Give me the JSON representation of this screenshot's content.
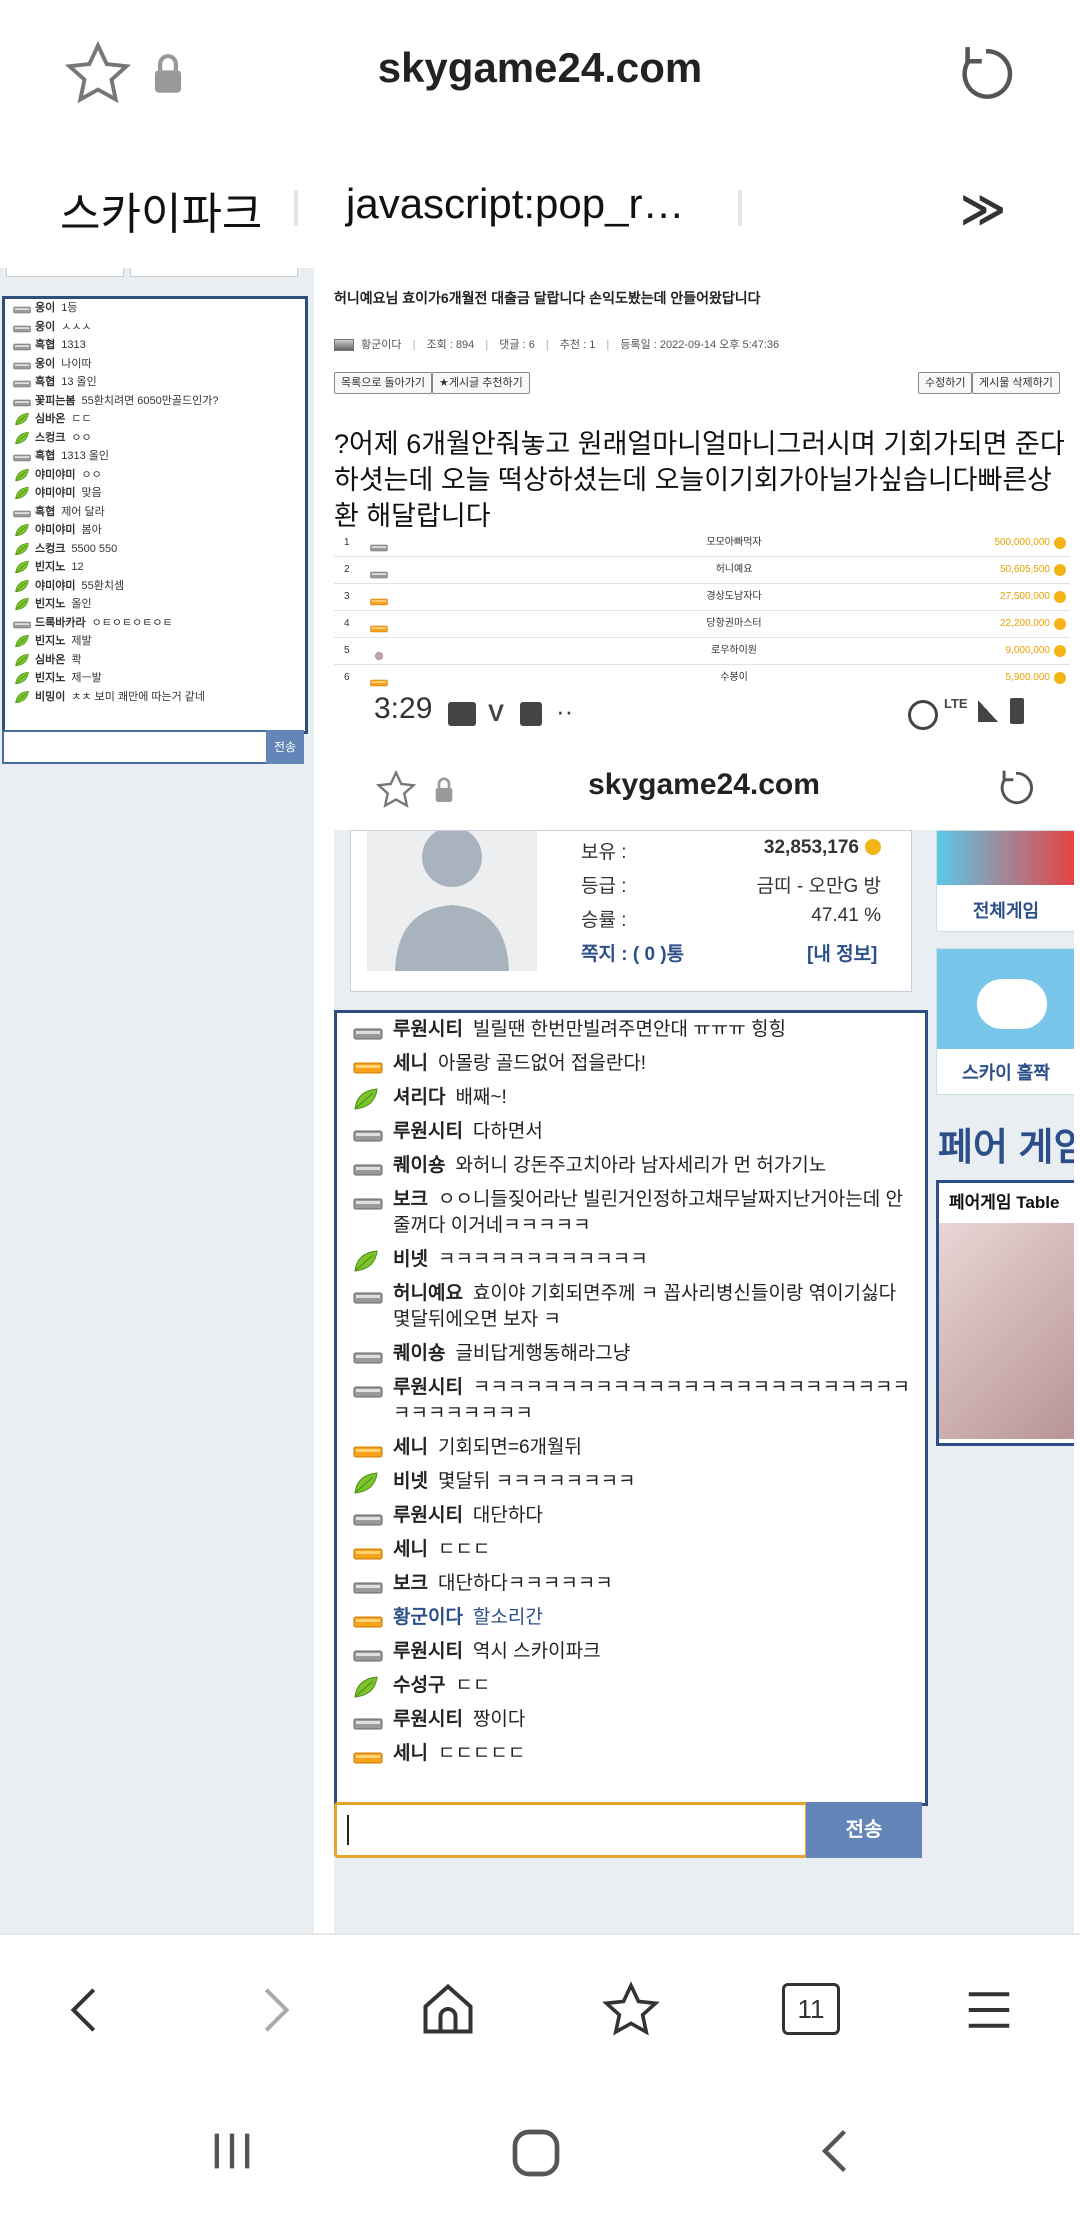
{
  "browser": {
    "url": "skygame24.com",
    "bookmarks": [
      "스카이파크",
      "javascript:pop_r…"
    ],
    "more": "≫"
  },
  "left_chat": {
    "lines": [
      {
        "user": "웅이",
        "msg": "1등",
        "icon": "gray"
      },
      {
        "user": "웅이",
        "msg": "ㅅㅅㅅ",
        "icon": "gray"
      },
      {
        "user": "흑협",
        "msg": "1313",
        "icon": "gray"
      },
      {
        "user": "웅이",
        "msg": "나이따",
        "icon": "gray"
      },
      {
        "user": "흑협",
        "msg": "13 올인",
        "icon": "gray"
      },
      {
        "user": "꽃피는봄",
        "msg": "55환치려면 6050만골드인가?",
        "icon": "gray"
      },
      {
        "user": "심바온",
        "msg": "ㄷㄷ",
        "icon": "leaf"
      },
      {
        "user": "스컹크",
        "msg": "ㅇㅇ",
        "icon": "leaf"
      },
      {
        "user": "흑협",
        "msg": "1313 올인",
        "icon": "gray"
      },
      {
        "user": "야미야미",
        "msg": "ㅇㅇ",
        "icon": "leaf"
      },
      {
        "user": "야미야미",
        "msg": "맞음",
        "icon": "leaf"
      },
      {
        "user": "흑협",
        "msg": "제어 달라",
        "icon": "gray"
      },
      {
        "user": "야미야미",
        "msg": "봄아",
        "icon": "leaf"
      },
      {
        "user": "스컹크",
        "msg": "5500 550",
        "icon": "leaf"
      },
      {
        "user": "빈지노",
        "msg": "12",
        "icon": "leaf"
      },
      {
        "user": "야미야미",
        "msg": "55환치셈",
        "icon": "leaf"
      },
      {
        "user": "빈지노",
        "msg": "올인",
        "icon": "leaf"
      },
      {
        "user": "드록바카라",
        "msg": "ㅇㅌㅇㅌㅇㅌㅇㅌ",
        "icon": "gray"
      },
      {
        "user": "빈지노",
        "msg": "제발",
        "icon": "leaf"
      },
      {
        "user": "심바온",
        "msg": "콱",
        "icon": "leaf"
      },
      {
        "user": "빈지노",
        "msg": "제ㅡ발",
        "icon": "leaf"
      },
      {
        "user": "비밍이",
        "msg": "ㅊㅊ 보미 쾌만에 따는거 같네",
        "icon": "leaf"
      }
    ],
    "send_label": "전송"
  },
  "post": {
    "title": "허니예요님  효이가6개월전 대출금 달랍니다 손익도봤는데 안들어왔답니다",
    "author": "황군이다",
    "views": "조회 : 894",
    "comments": "댓글 : 6",
    "recommend": "추천 : 1",
    "date": "등록일 : 2022-09-14 오후 5:47:36",
    "btn_list": "목록으로 돌아가기",
    "btn_recommend": "★게시글 추천하기",
    "btn_edit": "수정하기",
    "btn_delete": "게시물 삭제하기",
    "body": "?어제 6개월안줘놓고 원래얼마니얼마니그러시며 기회가되면 준다하셧는데 오늘 떡상하셨는데 오늘이기회가아닐가싶습니다빠른상환 해달랍니다"
  },
  "rank_table": [
    {
      "rank": "1",
      "name": "모모아빠먹자",
      "amount": "500,000,000",
      "icon": "gray"
    },
    {
      "rank": "2",
      "name": "허니예요",
      "amount": "50,605,500",
      "icon": "gray"
    },
    {
      "rank": "3",
      "name": "경상도남자다",
      "amount": "27,500,000",
      "icon": "orange"
    },
    {
      "rank": "4",
      "name": "당항권마스터",
      "amount": "22,200,000",
      "icon": "orange"
    },
    {
      "rank": "5",
      "name": "로우하이원",
      "amount": "9,000,000",
      "icon": "badge"
    },
    {
      "rank": "6",
      "name": "수봉이",
      "amount": "5,900,000",
      "icon": "orange"
    }
  ],
  "status": {
    "time": "3:29"
  },
  "inner": {
    "url": "skygame24.com",
    "profile": {
      "balance_label": "보유 :",
      "balance": "32,853,176",
      "grade_label": "등급 :",
      "grade": "금띠 - 오만G 방",
      "winrate_label": "승률 :",
      "winrate": "47.41 %",
      "messages": "쪽지 : ( 0 )통",
      "my_info": "[내 정보]"
    },
    "side": {
      "all_games": "전체게임",
      "sky_holjjak": "스카이 홀짝",
      "pair_game": "페어 게임",
      "pair_table": "페어게임 Table"
    },
    "chat": [
      {
        "user": "루원시티",
        "msg": "빌릴땐 한번만빌려주면안대 ㅠㅠㅠ 힝힝",
        "icon": "gray"
      },
      {
        "user": "세니",
        "msg": "아몰랑 골드없어 접을란다!",
        "icon": "orange"
      },
      {
        "user": "셔리다",
        "msg": "배째~!",
        "icon": "leaf"
      },
      {
        "user": "루원시티",
        "msg": "다하면서",
        "icon": "gray"
      },
      {
        "user": "퀘이숑",
        "msg": "와허니 강돈주고치아라 남자세리가 먼 허가기노",
        "icon": "gray"
      },
      {
        "user": "보크",
        "msg": "ㅇㅇ니들짖어라난 빌린거인정하고채무날짜지난거아는데 안줄꺼다 이거네ㅋㅋㅋㅋㅋ",
        "icon": "gray"
      },
      {
        "user": "비넷",
        "msg": "ㅋㅋㅋㅋㅋㅋㅋㅋㅋㅋㅋㅋ",
        "icon": "leaf"
      },
      {
        "user": "허니예요",
        "msg": "효이야 기회되면주께 ㅋ 꼽사리병신들이랑 엮이기싫다 몇달뒤에오면 보자 ㅋ",
        "icon": "gray"
      },
      {
        "user": "퀘이숑",
        "msg": "글비답게행동해라그냥",
        "icon": "gray"
      },
      {
        "user": "루원시티",
        "msg": "ㅋㅋㅋㅋㅋㅋㅋㅋㅋㅋㅋㅋㅋㅋㅋㅋㅋㅋㅋㅋㅋㅋㅋㅋㅋㅋㅋㅋㅋㅋㅋㅋㅋ",
        "icon": "gray"
      },
      {
        "user": "세니",
        "msg": "기회되면=6개월뒤",
        "icon": "orange"
      },
      {
        "user": "비넷",
        "msg": "몇달뒤 ㅋㅋㅋㅋㅋㅋㅋㅋ",
        "icon": "leaf"
      },
      {
        "user": "루원시티",
        "msg": "대단하다",
        "icon": "gray"
      },
      {
        "user": "세니",
        "msg": "ㄷㄷㄷ",
        "icon": "orange"
      },
      {
        "user": "보크",
        "msg": "대단하다ㅋㅋㅋㅋㅋㅋ",
        "icon": "gray"
      },
      {
        "user": "황군이다",
        "msg": "할소리간",
        "icon": "orange",
        "blue": true
      },
      {
        "user": "루원시티",
        "msg": "역시 스카이파크",
        "icon": "gray"
      },
      {
        "user": "수성구",
        "msg": "ㄷㄷ",
        "icon": "leaf"
      },
      {
        "user": "루원시티",
        "msg": "짱이다",
        "icon": "gray"
      },
      {
        "user": "세니",
        "msg": "ㄷㄷㄷㄷㄷ",
        "icon": "orange"
      }
    ],
    "send_label": "전송"
  },
  "colors": {
    "navy": "#2f4e7e",
    "accent_gold": "#e8a000",
    "send_blue": "#6485b8"
  },
  "bottom_nav": {
    "tabs_count": "11"
  }
}
